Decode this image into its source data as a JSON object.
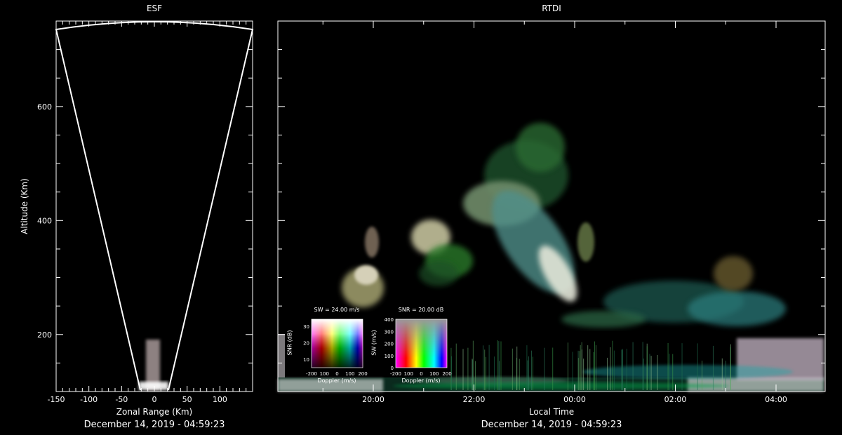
{
  "esf": {
    "title": "ESF",
    "xlabel": "Zonal Range (Km)",
    "ylabel": "Altitude (Km)",
    "date": "December 14, 2019 - 04:59:23",
    "xticks": [
      -150,
      -100,
      -50,
      0,
      50,
      100
    ],
    "yticks": [
      200,
      400,
      600
    ],
    "xlim": [
      -150,
      150
    ],
    "ylim": [
      100,
      750
    ]
  },
  "rtdi": {
    "title": "RTDI",
    "xlabel": "Local Time",
    "date": "December 14, 2019 - 04:59:23",
    "xticks": [
      "20:00",
      "22:00",
      "00:00",
      "02:00",
      "04:00"
    ]
  },
  "legend_sw": {
    "title": "SW = 24.00 m/s",
    "xlabel": "Doppler (m/s)",
    "ylabel": "SNR (dB)",
    "xticks": [
      "-200",
      "100",
      "0",
      "100",
      "200"
    ],
    "yticks": [
      "10",
      "20",
      "30"
    ]
  },
  "legend_snr": {
    "title": "SNR = 20.00 dB",
    "xlabel": "Doppler (m/s)",
    "ylabel": "SW (m/s)",
    "xticks": [
      "-200",
      "100",
      "0",
      "100",
      "200"
    ],
    "yticks": [
      "0",
      "100",
      "200",
      "300",
      "400"
    ]
  },
  "chart_data": [
    {
      "type": "heatmap",
      "title": "ESF",
      "xlabel": "Zonal Range (Km)",
      "ylabel": "Altitude (Km)",
      "xlim": [
        -150,
        150
      ],
      "ylim": [
        100,
        750
      ],
      "x_ticks": [
        -150,
        -100,
        -50,
        0,
        50,
        100
      ],
      "y_ticks": [
        200,
        400,
        600
      ]
    },
    {
      "type": "heatmap",
      "title": "RTDI",
      "xlabel": "Local Time",
      "x_ticks": [
        "20:00",
        "22:00",
        "00:00",
        "02:00",
        "04:00"
      ],
      "grid": false
    }
  ]
}
